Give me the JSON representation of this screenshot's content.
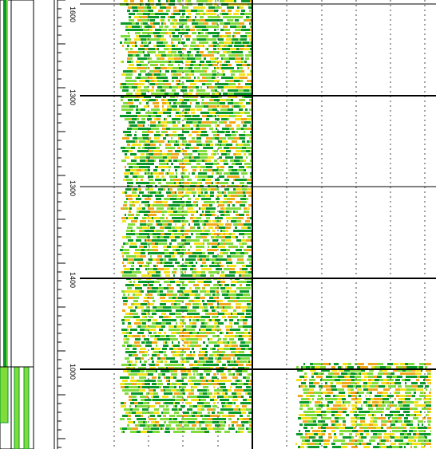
{
  "window": {
    "title": ""
  },
  "depth_axis": {
    "labels": [
      {
        "text": "1600",
        "depth": 1600
      },
      {
        "text": "1300",
        "depth": 1300
      },
      {
        "text": "1300",
        "depth": 1350
      },
      {
        "text": "1400",
        "depth": 1400
      },
      {
        "text": "1000",
        "depth": 1450
      }
    ]
  },
  "colors": {
    "green_dark": "#0a9a2a",
    "green_light": "#7fdc3a",
    "yellow": "#f3e21a",
    "orange": "#f0a81a",
    "grid_major": "#000000",
    "grid_dotted": "#444444",
    "track_border": "#000000"
  },
  "tracks": {
    "left_curves": "green-bar-curves",
    "main_seismic": "seismic-image-upper",
    "right_seismic": "seismic-image-lower"
  }
}
